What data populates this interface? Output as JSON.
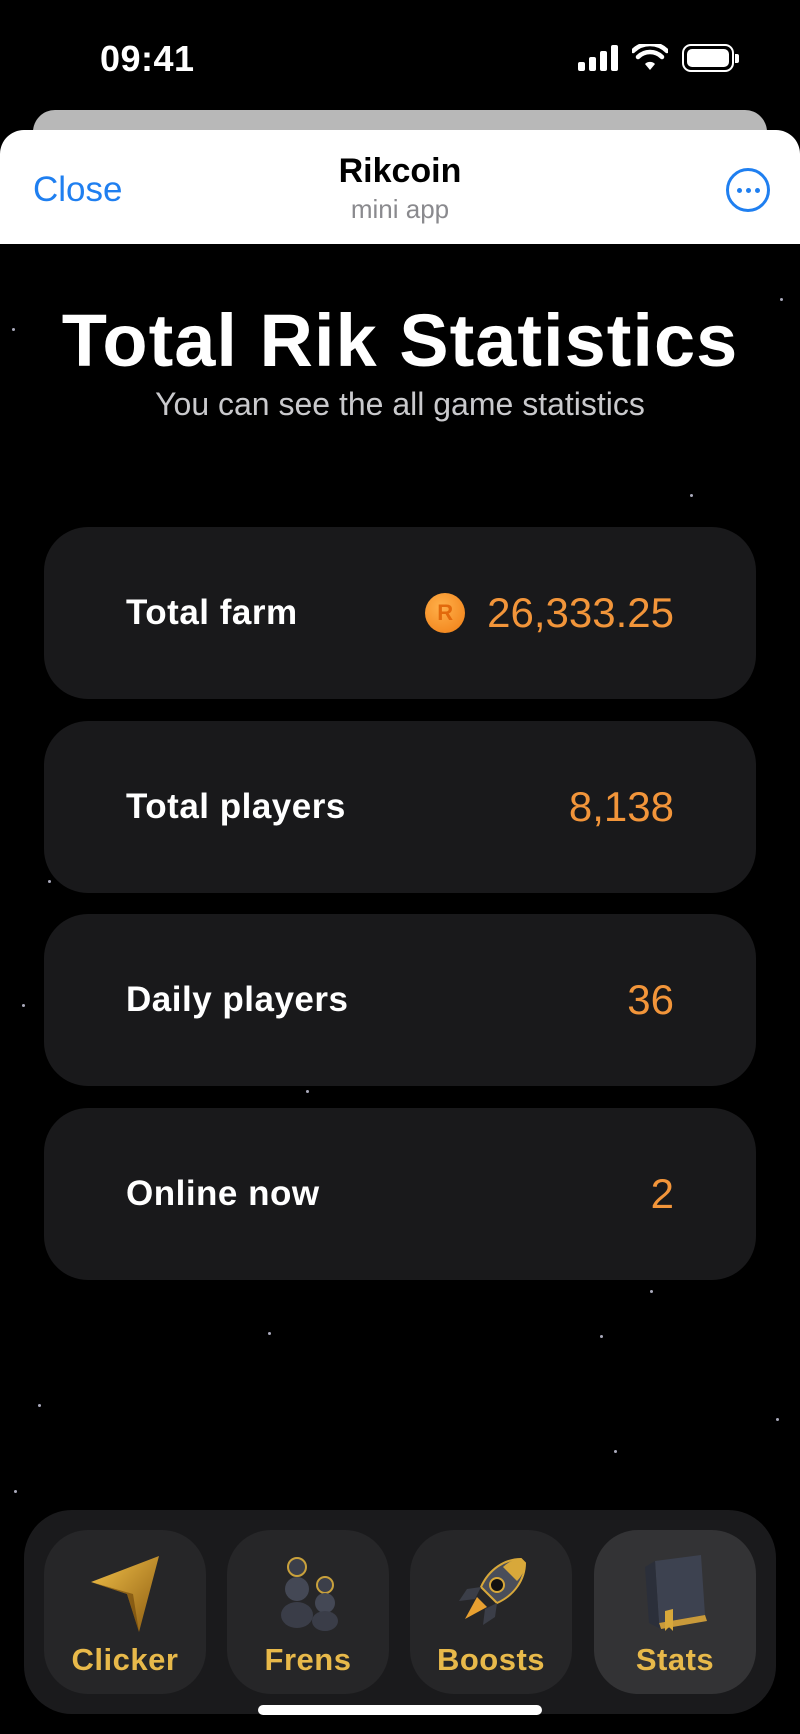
{
  "status_bar": {
    "time": "09:41"
  },
  "header": {
    "close_label": "Close",
    "title": "Rikcoin",
    "subtitle": "mini app"
  },
  "page": {
    "title": "Total Rik Statistics",
    "subtitle": "You can see the all game statistics"
  },
  "stats": [
    {
      "label": "Total farm",
      "value": "26,333.25",
      "icon": "rikcoin-icon"
    },
    {
      "label": "Total players",
      "value": "8,138"
    },
    {
      "label": "Daily players",
      "value": "36"
    },
    {
      "label": "Online now",
      "value": "2"
    }
  ],
  "coin_letter": "R",
  "nav": [
    {
      "label": "Clicker",
      "icon": "cursor-arrow-icon",
      "active": false
    },
    {
      "label": "Frens",
      "icon": "friends-icon",
      "active": false
    },
    {
      "label": "Boosts",
      "icon": "rocket-icon",
      "active": false
    },
    {
      "label": "Stats",
      "icon": "book-icon",
      "active": true
    }
  ],
  "colors": {
    "accent": "#f2953a",
    "nav_label": "#e8b94a",
    "link": "#1f7ff0",
    "card": "#19191b"
  }
}
